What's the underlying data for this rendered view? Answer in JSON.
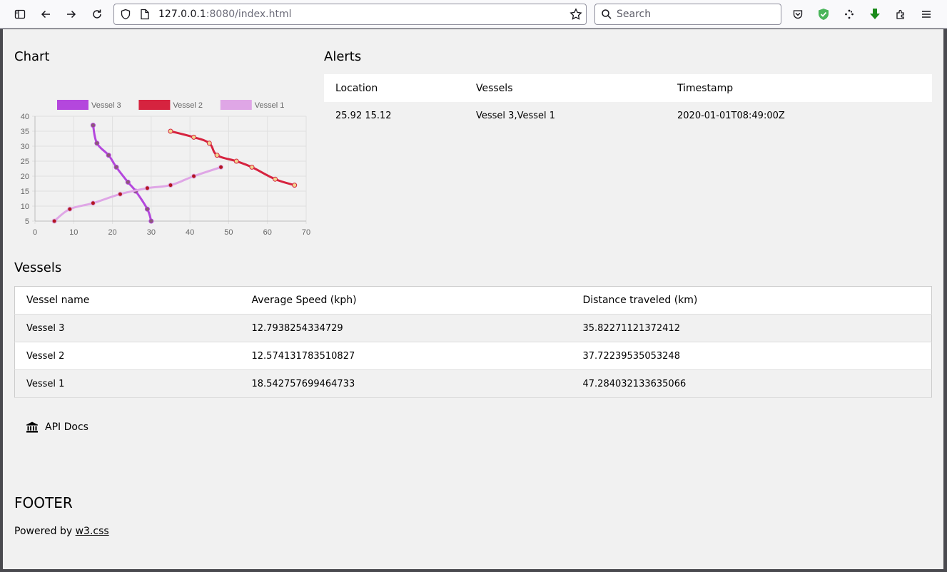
{
  "browser": {
    "url_host": "127.0.0.1",
    "url_rest": ":8080/index.html",
    "search_placeholder": "Search"
  },
  "chart": {
    "title": "Chart"
  },
  "chart_data": {
    "type": "line",
    "xlim": [
      0,
      70
    ],
    "ylim": [
      5,
      40
    ],
    "x_ticks": [
      0,
      10,
      20,
      30,
      40,
      50,
      60,
      70
    ],
    "y_ticks": [
      5,
      10,
      15,
      20,
      25,
      30,
      35,
      40
    ],
    "grid": true,
    "legend": "top",
    "series": [
      {
        "name": "Vessel 3",
        "color": "#b447dd",
        "point_color": "#8b5a76",
        "points": [
          [
            15,
            37
          ],
          [
            16,
            31
          ],
          [
            19,
            27
          ],
          [
            21,
            23
          ],
          [
            24,
            18
          ],
          [
            26,
            15
          ],
          [
            29,
            9
          ],
          [
            30,
            5
          ]
        ]
      },
      {
        "name": "Vessel 2",
        "color": "#d6233f",
        "point_color": "#f1d58e",
        "points": [
          [
            35,
            35
          ],
          [
            41,
            33
          ],
          [
            45,
            31
          ],
          [
            47,
            27
          ],
          [
            52,
            25
          ],
          [
            56,
            23
          ],
          [
            62,
            19
          ],
          [
            67,
            17
          ]
        ]
      },
      {
        "name": "Vessel 1",
        "color": "#dfa6e6",
        "point_color": "#b2151f",
        "points": [
          [
            5,
            5
          ],
          [
            9,
            9
          ],
          [
            15,
            11
          ],
          [
            22,
            14
          ],
          [
            29,
            16
          ],
          [
            35,
            17
          ],
          [
            41,
            20
          ],
          [
            48,
            23
          ]
        ]
      }
    ]
  },
  "alerts": {
    "title": "Alerts",
    "headers": [
      "Location",
      "Vessels",
      "Timestamp"
    ],
    "rows": [
      [
        "25.92 15.12",
        "Vessel 3,Vessel 1",
        "2020-01-01T08:49:00Z"
      ]
    ]
  },
  "vessels": {
    "title": "Vessels",
    "headers": [
      "Vessel name",
      "Average Speed (kph)",
      "Distance traveled (km)"
    ],
    "rows": [
      [
        "Vessel 3",
        "12.7938254334729",
        "35.82271121372412"
      ],
      [
        "Vessel 2",
        "12.574131783510827",
        "37.72239535053248"
      ],
      [
        "Vessel 1",
        "18.542757699464733",
        "47.284032133635066"
      ]
    ]
  },
  "api_docs": {
    "label": "API Docs",
    "icon": "bank-icon"
  },
  "footer": {
    "title": "FOOTER",
    "powered_by": "Powered by ",
    "link_text": "w3.css"
  }
}
